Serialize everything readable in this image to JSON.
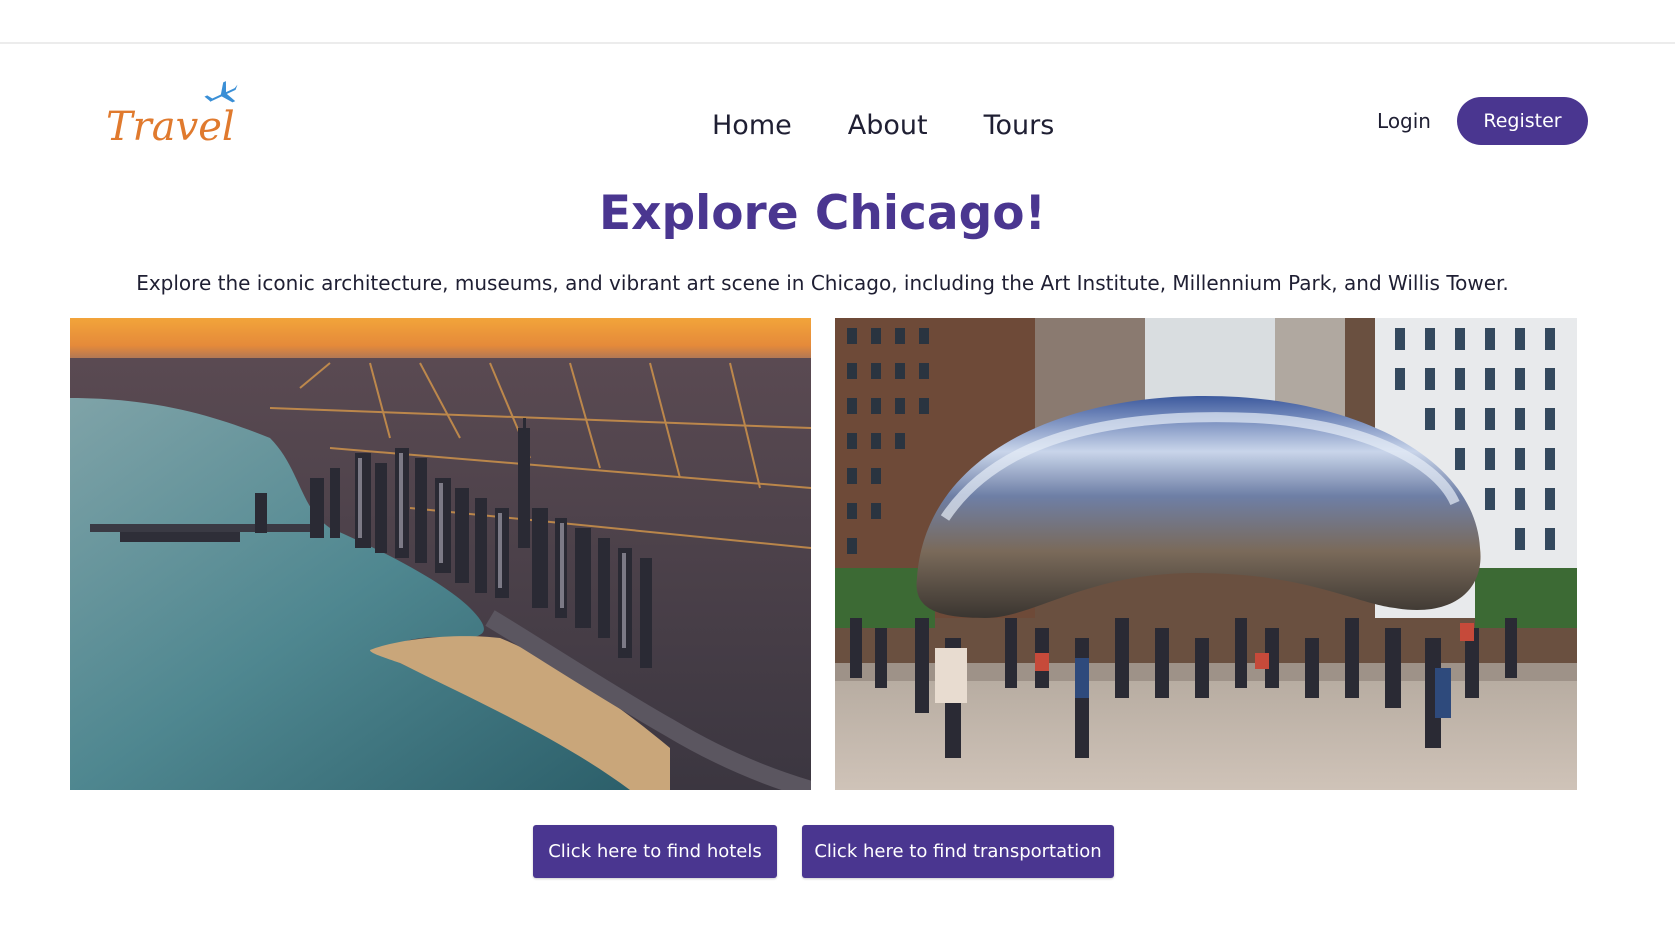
{
  "brand": {
    "logo_text": "Travel",
    "logo_color": "#e07a2e",
    "plane_color": "#3a8fd6"
  },
  "nav": {
    "items": [
      {
        "label": "Home"
      },
      {
        "label": "About"
      },
      {
        "label": "Tours"
      }
    ]
  },
  "auth": {
    "login_label": "Login",
    "register_label": "Register"
  },
  "hero": {
    "title": "Explore Chicago!",
    "subtitle": "Explore the iconic architecture, museums, and vibrant art scene in Chicago, including the Art Institute, Millennium Park, and Willis Tower."
  },
  "photos": {
    "left_icon": "chicago-skyline-aerial-photo",
    "right_icon": "cloud-gate-bean-photo"
  },
  "actions": {
    "hotels_label": "Click here to find hotels",
    "transport_label": "Click here to find transportation"
  },
  "colors": {
    "accent": "#4a3690",
    "text": "#1f1f33"
  }
}
